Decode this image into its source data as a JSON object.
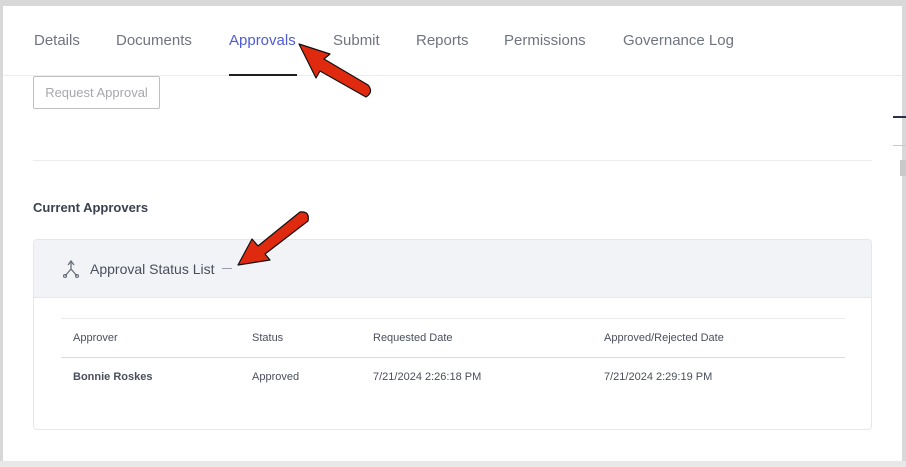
{
  "tabs": [
    {
      "label": "Details"
    },
    {
      "label": "Documents"
    },
    {
      "label": "Approvals"
    },
    {
      "label": "Submit"
    },
    {
      "label": "Reports"
    },
    {
      "label": "Permissions"
    },
    {
      "label": "Governance Log"
    }
  ],
  "active_tab": "Approvals",
  "request_button": "Request Approval",
  "section_title": "Current Approvers",
  "panel": {
    "title": "Approval Status List",
    "collapse_icon": "minus-icon",
    "icon": "approval-flow-icon"
  },
  "table": {
    "headers": [
      "Approver",
      "Status",
      "Requested Date",
      "Approved/Rejected Date"
    ],
    "rows": [
      [
        "Bonnie Roskes",
        "Approved",
        "7/21/2024 2:26:18 PM",
        "7/21/2024 2:29:19 PM"
      ]
    ]
  },
  "colors": {
    "accent": "#4f5bd5",
    "annotation_arrow": "#e02a10"
  }
}
